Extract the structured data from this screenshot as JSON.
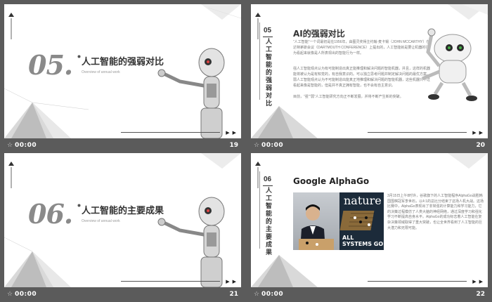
{
  "slides": [
    {
      "big_num": "05.",
      "title": "人工智能的强弱对比",
      "subtitle": "Overview   of annual work",
      "footer_time": "00:00",
      "page": "19"
    },
    {
      "section_num": "05",
      "side_title": "人工智能的强弱对比",
      "title": "AI的强弱对比",
      "para1": "“人工智能”一个词最初是在1956年，由图灵奖得主约翰·麦卡锡（JOHN MCCARTHY）在达特茅斯会议（DARTMOUTH CONFERENCE）上提出的，人工智能就是要让机器的行为看起来就像是人所表现出的智能行为一样。",
      "para2": "强人工智能观点认为有可能制造出真正能推理和解决问题的智能机器，并且，这样的机器能将被认为是有知觉的，有自我意识的。可以独立思考问题并制定解决问题的最优方案。弱人工智能观点认为不可能制造出能真正地推理和解决问题的智能机器，这些机器只不过看起来像是智能的，但是并不真正拥有智能，也不会有自主意识。",
      "para3": "目前，“强”“弱”人工智能研究方向正不断发展，并将不断产生新的突破。",
      "footer_time": "00:00",
      "page": "20"
    },
    {
      "big_num": "06.",
      "title": "人工智能的主要成果",
      "subtitle": "Overview   of annual work",
      "footer_time": "00:00",
      "page": "21"
    },
    {
      "section_num": "06",
      "side_title": "人工智能的主要成果",
      "title": "Google AlphaGo",
      "cover_text": "nature",
      "cover_headline": "ALL SYSTEMS GO",
      "para": "3月15日上午8时许，谷歌旗下的人工智能程序AlphaGo战胜韩国围棋冠军李世石，以4:1的总比分结束了这场人机大战。这场比赛中，AlphaGo表现出了非常强的计算能力和学习能力，它的决策过程模仿了人类大脑的神经网络，通过深度学习和强化学习不断提高自身水平。AlphaGo的成功标志着人工智能在复杂决策领域取得了重大突破，也让全世界看到了人工智能的巨大潜力和无限可能。",
      "footer_time": "00:00",
      "page": "22"
    }
  ]
}
